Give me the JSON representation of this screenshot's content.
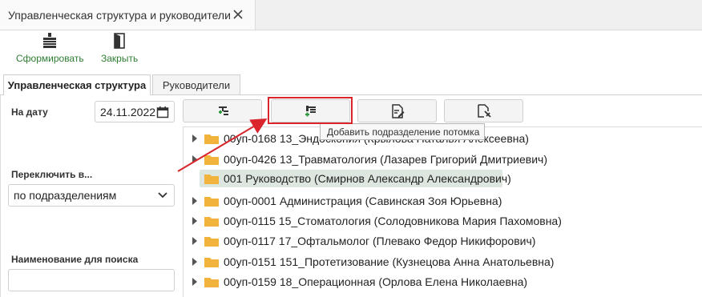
{
  "window": {
    "tab_title": "Управленческая структура и руководители",
    "close_icon": "close-icon"
  },
  "toolbar": {
    "form_label": "Сформировать",
    "close_label": "Закрыть",
    "accent": "#2e7d32"
  },
  "tabs": [
    {
      "label": "Управленческая структура",
      "active": true
    },
    {
      "label": "Руководители",
      "active": false
    }
  ],
  "filters": {
    "date_label": "На дату",
    "date_value": "24.11.2022",
    "switch_label": "Переключить в...",
    "switch_value": "по подразделениям",
    "search_label": "Наименование для поиска",
    "search_value": ""
  },
  "actions": [
    {
      "name": "add-sibling",
      "icon": "add-node-icon"
    },
    {
      "name": "add-child",
      "icon": "add-child-node-icon"
    },
    {
      "name": "edit",
      "icon": "edit-icon"
    },
    {
      "name": "pick",
      "icon": "pick-icon"
    }
  ],
  "tooltip": "Добавить подразделение потомка",
  "tree": [
    {
      "text": "00уп-0168 13_Эндоскопия (Крылова Наталья Алексеевна)",
      "expandable": true,
      "selected": false
    },
    {
      "text": "00уп-0426 13_Травматология (Лазарев Григорий Дмитриевич)",
      "expandable": true,
      "selected": false
    },
    {
      "text": "001 Руководство (Смирнов Александр Александрович)",
      "expandable": false,
      "selected": true
    },
    {
      "text": "00уп-0001 Администрация (Савинская Зоя Юрьевна)",
      "expandable": true,
      "selected": false
    },
    {
      "text": "00уп-0115 15_Стоматология (Солодовникова Мария Пахомовна)",
      "expandable": true,
      "selected": false
    },
    {
      "text": "00уп-0117 17_Офтальмолог (Плевако Федор Никифорович)",
      "expandable": true,
      "selected": false
    },
    {
      "text": "00уп-0151 151_Протетизование (Кузнецова Анна Анатольевна)",
      "expandable": true,
      "selected": false
    },
    {
      "text": "00уп-0159 18_Операционная (Орлова Елена Николаевна)",
      "expandable": true,
      "selected": false
    }
  ],
  "colors": {
    "highlight": "#d9252b",
    "folder": "#f2b33d",
    "selected_row": "#dde6df"
  }
}
